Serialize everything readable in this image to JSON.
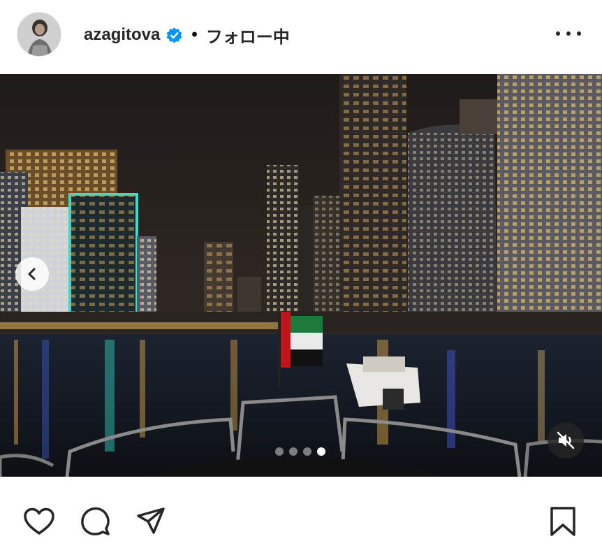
{
  "post": {
    "username": "azagitova",
    "separator": "•",
    "follow_status": "フォロー中",
    "verified": true,
    "carousel": {
      "slide_count": 4,
      "active_index": 3
    },
    "icons": {
      "avatar": "profile-photo",
      "verified": "verified-badge-icon",
      "more": "more-options-icon",
      "prev": "chevron-left-icon",
      "mute": "speaker-muted-icon",
      "like": "heart-icon",
      "comment": "comment-bubble-icon",
      "share": "paper-plane-icon",
      "save": "bookmark-icon"
    },
    "colors": {
      "verified_blue": "#0095f6",
      "text": "#262626"
    }
  }
}
